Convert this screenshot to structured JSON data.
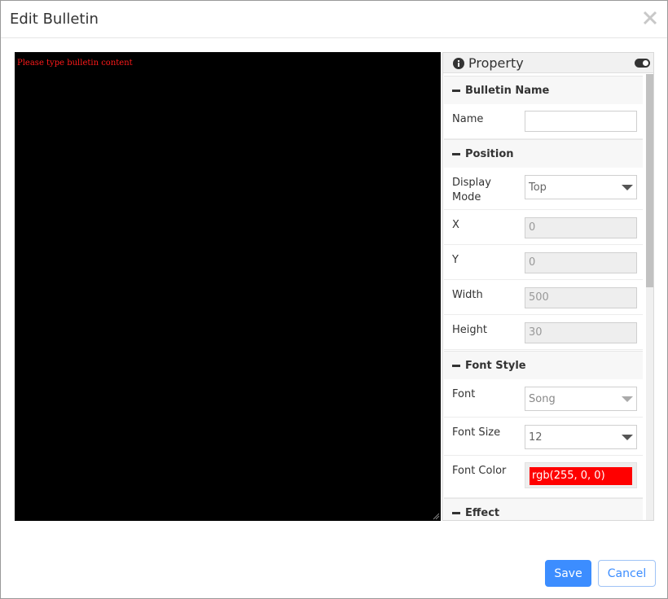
{
  "dialog": {
    "title": "Edit Bulletin"
  },
  "editor": {
    "content": "Please type bulletin content",
    "text_color": "#ff0000",
    "background": "#000000"
  },
  "panel": {
    "title": "Property",
    "sections": {
      "bulletin_name": "Bulletin Name",
      "position": "Position",
      "font_style": "Font Style",
      "effect": "Effect"
    },
    "fields": {
      "name": {
        "label": "Name",
        "value": ""
      },
      "display_mode": {
        "label": "Display Mode",
        "value": "Top"
      },
      "x": {
        "label": "X",
        "value": "0"
      },
      "y": {
        "label": "Y",
        "value": "0"
      },
      "width": {
        "label": "Width",
        "value": "500"
      },
      "height": {
        "label": "Height",
        "value": "30"
      },
      "font": {
        "label": "Font",
        "value": "Song"
      },
      "font_size": {
        "label": "Font Size",
        "value": "12"
      },
      "font_color": {
        "label": "Font Color",
        "value": "rgb(255, 0, 0)",
        "color": "#ff0000"
      }
    }
  },
  "footer": {
    "save_label": "Save",
    "cancel_label": "Cancel"
  }
}
